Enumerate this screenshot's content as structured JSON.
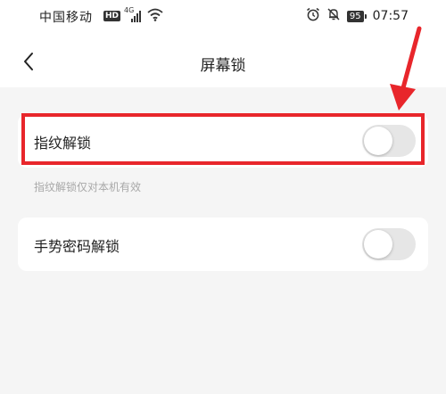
{
  "status_bar": {
    "carrier": "中国移动",
    "hd_badge": "HD",
    "network": "4G",
    "battery": "95",
    "time": "07:57"
  },
  "header": {
    "title": "屏幕锁"
  },
  "settings": {
    "fingerprint": {
      "label": "指纹解锁",
      "enabled": false,
      "hint": "指纹解锁仅对本机有效"
    },
    "gesture": {
      "label": "手势密码解锁",
      "enabled": false
    }
  },
  "colors": {
    "highlight": "#e8262b",
    "toggle_off": "#e6e6e6",
    "background": "#f5f5f5"
  },
  "icons": {
    "back": "chevron-left-icon",
    "signal": "signal-icon",
    "wifi": "wifi-icon",
    "alarm": "alarm-icon",
    "mute": "bell-off-icon",
    "annotation": "red-arrow-icon"
  }
}
